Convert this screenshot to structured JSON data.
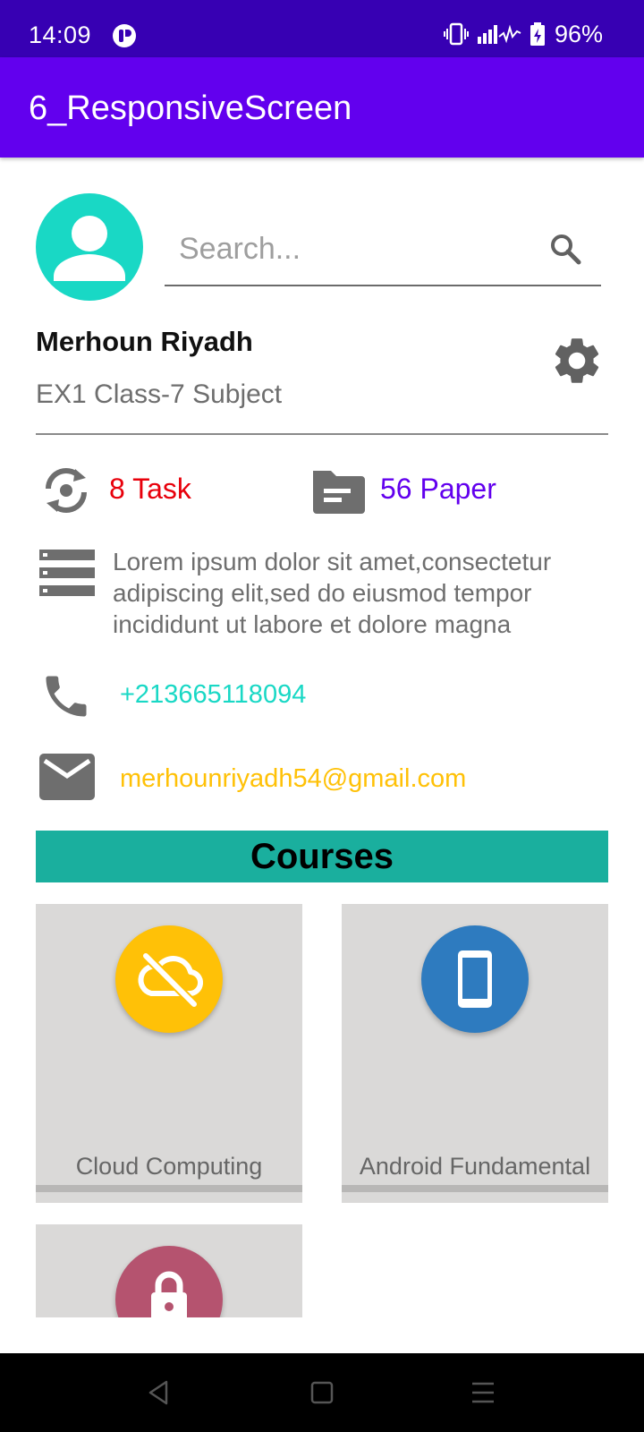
{
  "status_bar": {
    "time": "14:09",
    "battery": "96%"
  },
  "app_bar": {
    "title": "6_ResponsiveScreen"
  },
  "search": {
    "placeholder": "Search..."
  },
  "profile": {
    "name": "Merhoun Riyadh",
    "subtitle": "EX1 Class-7 Subject"
  },
  "stats": {
    "tasks": "8 Task",
    "papers": "56 Paper"
  },
  "description": "Lorem ipsum dolor sit amet,consectetur adipiscing elit,sed do eiusmod tempor incididunt ut labore et dolore magna",
  "contact": {
    "phone": "+213665118094",
    "email": "merhounriyadh54@gmail.com"
  },
  "courses": {
    "title": "Courses",
    "items": [
      {
        "label": "Cloud Computing",
        "icon": "cloud-off-icon",
        "color": "#ffc107"
      },
      {
        "label": "Android Fundamental",
        "icon": "phone-android-icon",
        "color": "#2e7bbf"
      },
      {
        "label": "",
        "icon": "lock-icon",
        "color": "#b5536f"
      }
    ]
  },
  "colors": {
    "status_bar": "#3700b3",
    "app_bar": "#6200ee",
    "accent_teal": "#19d8c5",
    "courses_header": "#1aaf9e",
    "task_red": "#e8000b",
    "paper_purple": "#6200ee",
    "email_amber": "#ffc107"
  }
}
